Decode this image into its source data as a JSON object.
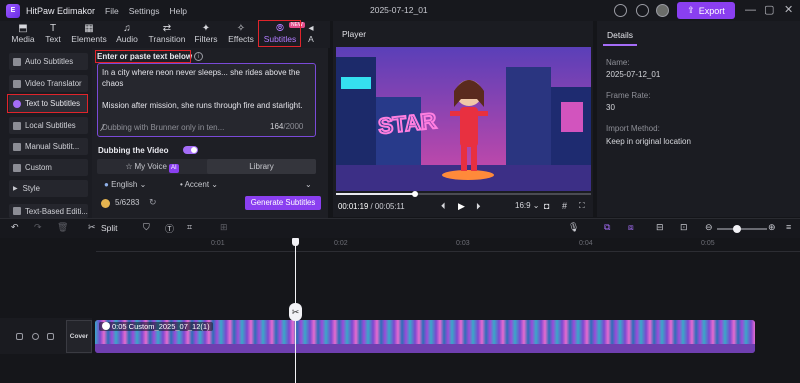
{
  "app": {
    "name": "HitPaw Edimakor",
    "menu": [
      "File",
      "Settings",
      "Help"
    ],
    "project_title": "2025-07-12_01",
    "export_label": "Export",
    "accent_color": "#8a3ff0"
  },
  "tool_tabs": [
    {
      "label": "Media",
      "icon": "media-icon"
    },
    {
      "label": "Text",
      "icon": "text-icon"
    },
    {
      "label": "Elements",
      "icon": "elements-icon"
    },
    {
      "label": "Audio",
      "icon": "audio-icon"
    },
    {
      "label": "Transition",
      "icon": "transition-icon"
    },
    {
      "label": "Filters",
      "icon": "filters-icon"
    },
    {
      "label": "Effects",
      "icon": "effects-icon"
    },
    {
      "label": "Subtitles",
      "icon": "subtitles-icon",
      "active": true
    },
    {
      "label": "A",
      "icon": "more-icon"
    }
  ],
  "new_badge": "NEW",
  "sidebar": {
    "items": [
      {
        "label": "Auto Subtitles"
      },
      {
        "label": "Video Translator"
      },
      {
        "label": "Text to Subtitles",
        "active": true
      },
      {
        "label": "Local Subtitles"
      },
      {
        "label": "Manual Subtit..."
      },
      {
        "label": "Custom"
      },
      {
        "label": "Style"
      },
      {
        "label": "Text-Based Editi..."
      }
    ]
  },
  "text_panel": {
    "heading": "Enter or paste text below",
    "text_lines": [
      "In a city where neon never sleeps... she rides above the chaos",
      "",
      "Mission after mission, she runs through fire and starlight.",
      "",
      "Dubbing with Brunner only in ten..."
    ],
    "char_count": "164",
    "char_max": "/2000",
    "dubbing_label": "Dubbing the Video",
    "dubbing_enabled": true,
    "my_voice_label": "My Voice",
    "ai_badge": "AI",
    "library_label": "Library",
    "language": "English",
    "accent": "Accent",
    "credits": "5/6283",
    "generate_label": "Generate Subtitles"
  },
  "player": {
    "title": "Player",
    "current_time": "00:01:19",
    "total_time": "/ 00:05:11",
    "progress": 0.3,
    "aspect": "16:9",
    "neon_sign": "STAR"
  },
  "details": {
    "tab_label": "Details",
    "fields": [
      {
        "label": "Name:",
        "value": "2025-07-12_01"
      },
      {
        "label": "Frame Rate:",
        "value": "30"
      },
      {
        "label": "Import Method:",
        "value": "Keep in original location"
      }
    ]
  },
  "timeline": {
    "split_label": "Split",
    "ticks": [
      "0:01",
      "0:02",
      "0:03",
      "0:04",
      "0:05"
    ],
    "clip_label": "0:05 Custom_2025_07_12(1)",
    "cover_label": "Cover"
  }
}
